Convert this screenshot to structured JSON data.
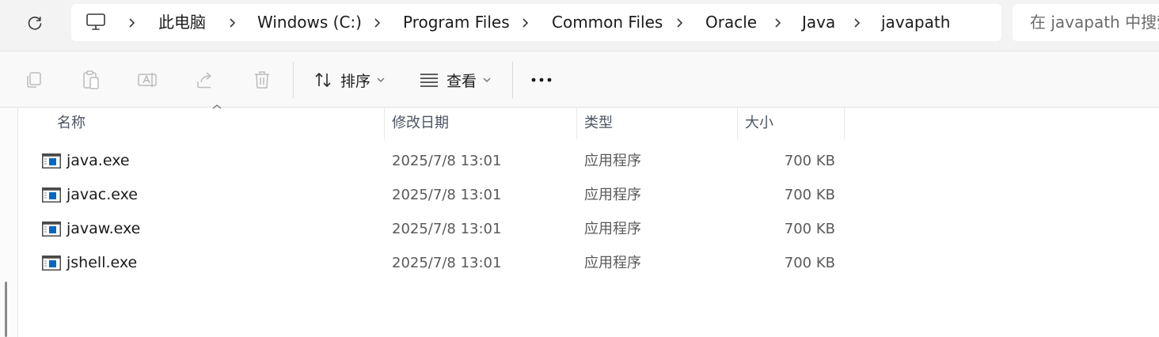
{
  "address_bar": {
    "breadcrumb": [
      "此电脑",
      "Windows (C:)",
      "Program Files",
      "Common Files",
      "Oracle",
      "Java",
      "javapath"
    ],
    "search_placeholder": "在 javapath 中搜索"
  },
  "toolbar": {
    "sort_label": "排序",
    "view_label": "查看"
  },
  "columns": {
    "name": "名称",
    "modified": "修改日期",
    "type": "类型",
    "size": "大小"
  },
  "files": [
    {
      "name": "java.exe",
      "modified": "2025/7/8 13:01",
      "type": "应用程序",
      "size": "700 KB"
    },
    {
      "name": "javac.exe",
      "modified": "2025/7/8 13:01",
      "type": "应用程序",
      "size": "700 KB"
    },
    {
      "name": "javaw.exe",
      "modified": "2025/7/8 13:01",
      "type": "应用程序",
      "size": "700 KB"
    },
    {
      "name": "jshell.exe",
      "modified": "2025/7/8 13:01",
      "type": "应用程序",
      "size": "700 KB"
    }
  ],
  "colors": {
    "accent": "#0067c0",
    "toolbar_bg": "#f9f9f9",
    "address_bg": "#f3f3f3"
  },
  "icons": {
    "refresh": "refresh-icon",
    "computer": "computer-icon",
    "copy": "copy-icon",
    "paste": "paste-icon",
    "rename": "rename-icon",
    "share": "share-icon",
    "delete": "trash-icon",
    "sort": "sort-arrows-icon",
    "view": "view-lines-icon",
    "more": "more-dots-icon",
    "file": "exe-file-icon"
  }
}
